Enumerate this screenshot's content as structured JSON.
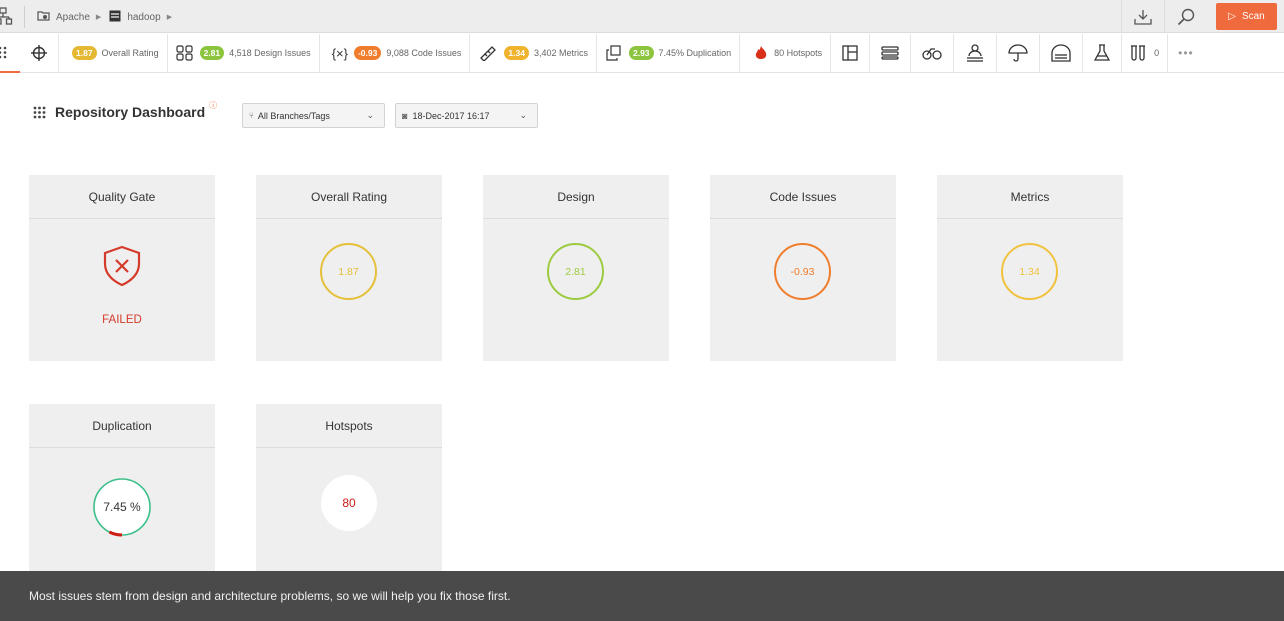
{
  "breadcrumb": {
    "items": [
      {
        "label": "Apache",
        "icon": "folder-icon"
      },
      {
        "label": "hadoop",
        "icon": "repository-icon"
      }
    ]
  },
  "scan_button": {
    "label": "Scan"
  },
  "metrics_bar": {
    "overall_rating": {
      "value": "1.87",
      "label": "Overall Rating",
      "color": "#e5b834"
    },
    "design": {
      "value": "2.81",
      "label": "4,518 Design Issues",
      "color": "#8cc43e"
    },
    "code_issues": {
      "value": "-0.93",
      "label": "9,088 Code Issues",
      "color": "#ef7d2c"
    },
    "metrics": {
      "value": "1.34",
      "label": "3,402 Metrics",
      "color": "#f0b32e"
    },
    "duplication": {
      "value": "2.93",
      "label": "7.45% Duplication",
      "color": "#8cc43e"
    },
    "hotspots": {
      "label": "80 Hotspots"
    },
    "tests": {
      "label": "0"
    }
  },
  "dashboard": {
    "title": "Repository Dashboard",
    "branch_select": "All Branches/Tags",
    "date_select": "18-Dec-2017 16:17"
  },
  "cards": {
    "quality_gate": {
      "title": "Quality Gate",
      "status": "FAILED"
    },
    "overall_rating": {
      "title": "Overall Rating",
      "value": "1.87",
      "color": "#e5c03a"
    },
    "design": {
      "title": "Design",
      "value": "2.81",
      "color": "#9ccb3f"
    },
    "code_issues": {
      "title": "Code Issues",
      "value": "-0.93",
      "color": "#ef7d2c"
    },
    "metrics": {
      "title": "Metrics",
      "value": "1.34",
      "color": "#f0c23e"
    },
    "duplication": {
      "title": "Duplication",
      "value": "7.45 %",
      "fraction": 0.0745,
      "color": "#3dbf8a"
    },
    "hotspots": {
      "title": "Hotspots",
      "value": "80"
    }
  },
  "tip": "Most issues stem from design and architecture problems, so we will help you fix those first."
}
